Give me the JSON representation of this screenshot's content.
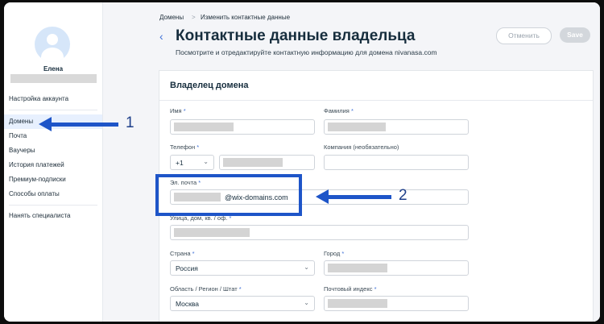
{
  "sidebar": {
    "user_name": "Елена",
    "items": [
      {
        "label": "Настройка аккаунта"
      },
      {
        "label": "Домены"
      },
      {
        "label": "Почта"
      },
      {
        "label": "Ваучеры"
      },
      {
        "label": "История платежей"
      },
      {
        "label": "Премиум-подписки"
      },
      {
        "label": "Способы оплаты"
      },
      {
        "label": "Нанять специалиста"
      }
    ]
  },
  "header": {
    "breadcrumb": [
      "Домены",
      "Изменить контактные данные"
    ],
    "breadcrumb_sep": ">",
    "back_icon": "‹",
    "title": "Контактные данные владельца",
    "subtitle": "Посмотрите и отредактируйте контактную информацию для домена nivanasa.com",
    "cancel_label": "Отменить",
    "save_label": "Save"
  },
  "form": {
    "section_title": "Владелец домена",
    "first_name_label": "Имя",
    "last_name_label": "Фамилия",
    "phone_label": "Телефон",
    "phone_code": "+1",
    "company_label": "Компания (необязательно)",
    "email_label": "Эл. почта",
    "email_suffix": "@wix-domains.com",
    "address_label": "Улица, дом, кв. / оф.",
    "country_label": "Страна",
    "country_value": "Россия",
    "city_label": "Город",
    "region_label": "Область / Регион / Штат",
    "region_value": "Москва",
    "zip_label": "Почтовый индекс",
    "required_mark": "*"
  },
  "annotations": {
    "marker_1": "1",
    "marker_2": "2",
    "color": "#1e55c8"
  }
}
